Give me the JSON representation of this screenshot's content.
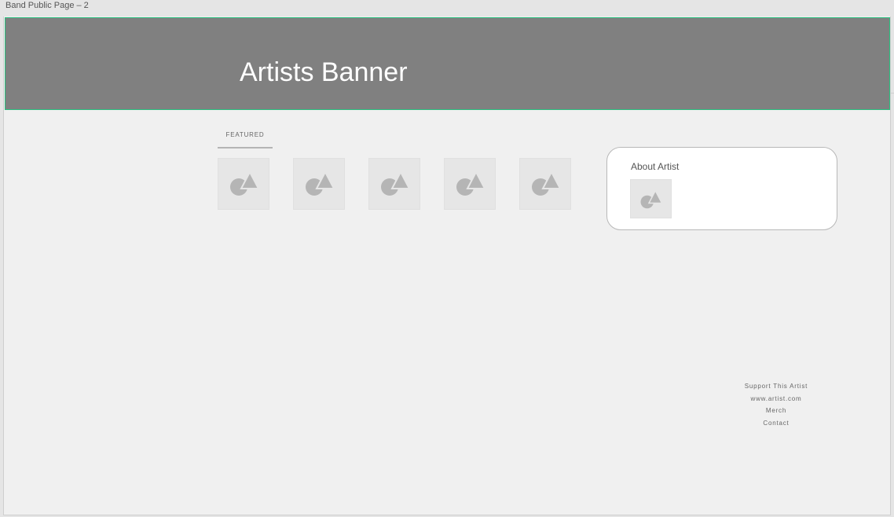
{
  "artboard": {
    "label": "Band Public Page – 2"
  },
  "banner": {
    "title": "Artists Banner"
  },
  "featured": {
    "tab_label": "FEATURED",
    "items": [
      {
        "icon": "image-placeholder-icon"
      },
      {
        "icon": "image-placeholder-icon"
      },
      {
        "icon": "image-placeholder-icon"
      },
      {
        "icon": "image-placeholder-icon"
      },
      {
        "icon": "image-placeholder-icon"
      }
    ]
  },
  "about": {
    "title": "About Artist",
    "thumb_icon": "image-placeholder-icon"
  },
  "footer": {
    "links": [
      "Support This Artist",
      "www.artist.com",
      "Merch",
      "Contact"
    ]
  },
  "colors": {
    "banner_bg": "#808080",
    "selection_outline": "#2bbf7f",
    "canvas_bg": "#f0f0f0",
    "placeholder_bg": "#e6e6e6",
    "placeholder_shape": "#b5b5b5"
  }
}
